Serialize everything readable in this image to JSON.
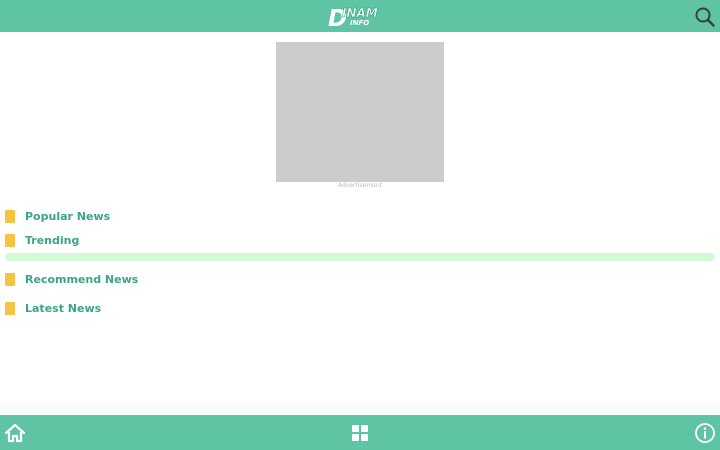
{
  "header": {
    "logo_text_top": "INAM",
    "logo_text_bottom": "INFO",
    "logo_letter": "D",
    "search_icon": "search-icon",
    "bg_color": "#5ec4a3"
  },
  "advertisement": {
    "label": "Advertisement"
  },
  "sections": [
    {
      "label": "Popular News"
    },
    {
      "label": "Trending"
    },
    {
      "label": "Recommend News"
    },
    {
      "label": "Latest News"
    }
  ],
  "bottom_nav": {
    "items": [
      {
        "icon": "home-icon"
      },
      {
        "icon": "grid-icon"
      },
      {
        "icon": "info-icon"
      }
    ]
  },
  "colors": {
    "accent": "#5ec4a3",
    "section_text": "#3aa585",
    "section_marker": "#f6c443",
    "loading_strip": "#d3fbd6"
  }
}
